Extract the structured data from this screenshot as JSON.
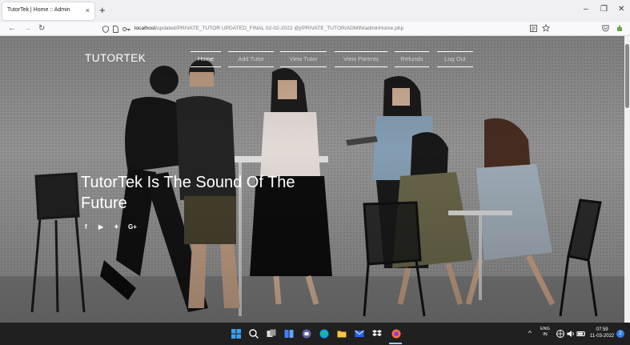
{
  "browser": {
    "tab_title": "TutorTek | Home :: Admin",
    "tab_close": "×",
    "new_tab": "+",
    "window_controls": {
      "minimize": "–",
      "restore": "❐",
      "close": "✕"
    },
    "nav": {
      "back": "←",
      "forward": "→",
      "reload": "↻"
    },
    "url_host": "localhost",
    "url_path": "/updated/PRIVATE_TUTOR UPDATED_FINAL 02-02-2022 @j/PRIVATE_TUTOR/ADMIN/adminHome.php"
  },
  "site": {
    "brand": "TUTORTEK",
    "menu": [
      {
        "label": "Home",
        "active": true
      },
      {
        "label": "Add Tutor",
        "active": false
      },
      {
        "label": "View Tutor",
        "active": false
      },
      {
        "label": "View Parents",
        "active": false
      },
      {
        "label": "Refunds",
        "active": false
      },
      {
        "label": "Log Out",
        "active": false
      }
    ],
    "headline_line1": "TutorTek Is The Sound Of The",
    "headline_line2": "Future",
    "social": [
      "f",
      "▶",
      "✦",
      "G+"
    ]
  },
  "taskbar": {
    "lang_top": "ENG",
    "lang_bottom": "IN",
    "time": "07:59",
    "date": "11-03-2022",
    "badge": "2",
    "tray_chevron": "^"
  },
  "colors": {
    "taskbar": "#202020",
    "tabstrip": "#f0f0f4",
    "accent_blue": "#2f80ed"
  }
}
